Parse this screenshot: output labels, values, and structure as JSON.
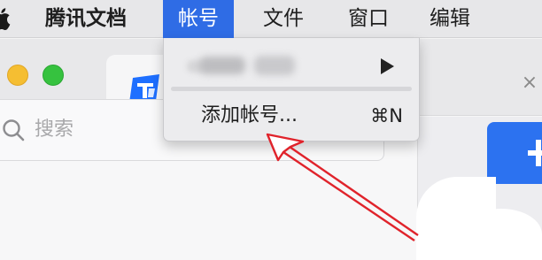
{
  "menubar": {
    "app_name": "腾讯文档",
    "items": [
      "帐号",
      "文件",
      "窗口",
      "编辑"
    ]
  },
  "dropdown": {
    "add_account_label": "添加帐号...",
    "add_account_shortcut": "⌘N"
  },
  "search": {
    "placeholder": "搜索"
  },
  "colors": {
    "menu_highlight": "#2f6ce5",
    "annotation_arrow": "#e0232b",
    "primary_button": "#2c72f0"
  }
}
